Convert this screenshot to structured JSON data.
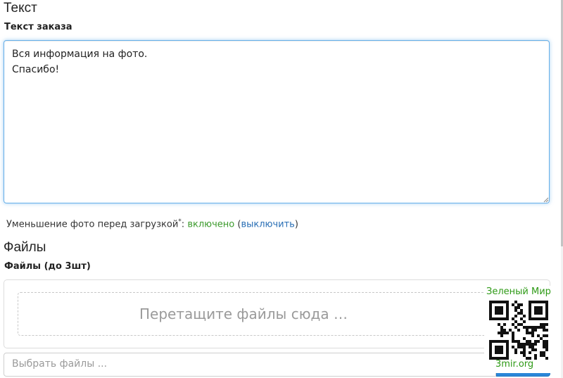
{
  "text_section": {
    "title": "Текст",
    "label": "Текст заказа",
    "value": "Вся информация на фото.\nСпасибо!"
  },
  "photo_shrink": {
    "label": "Уменьшение фото перед загрузкой",
    "marker": "*",
    "colon": ":",
    "status": "включено",
    "open_paren": " (",
    "toggle_link": "выключить",
    "close_paren": ")"
  },
  "files_section": {
    "title": "Файлы",
    "label": "Файлы (до 3шт)",
    "dropzone_text": "Перетащите файлы сюда …",
    "input_placeholder": "Выбрать файлы ..."
  },
  "watermark": {
    "top_text": "Зеленый Мир",
    "bottom_text": "3mir.org"
  },
  "colors": {
    "accent_blue": "#2a86d8",
    "focus_border": "#66afe9",
    "status_green": "#3c9a2c",
    "link_blue": "#2a6fb5",
    "watermark_green": "#2e9a16"
  }
}
